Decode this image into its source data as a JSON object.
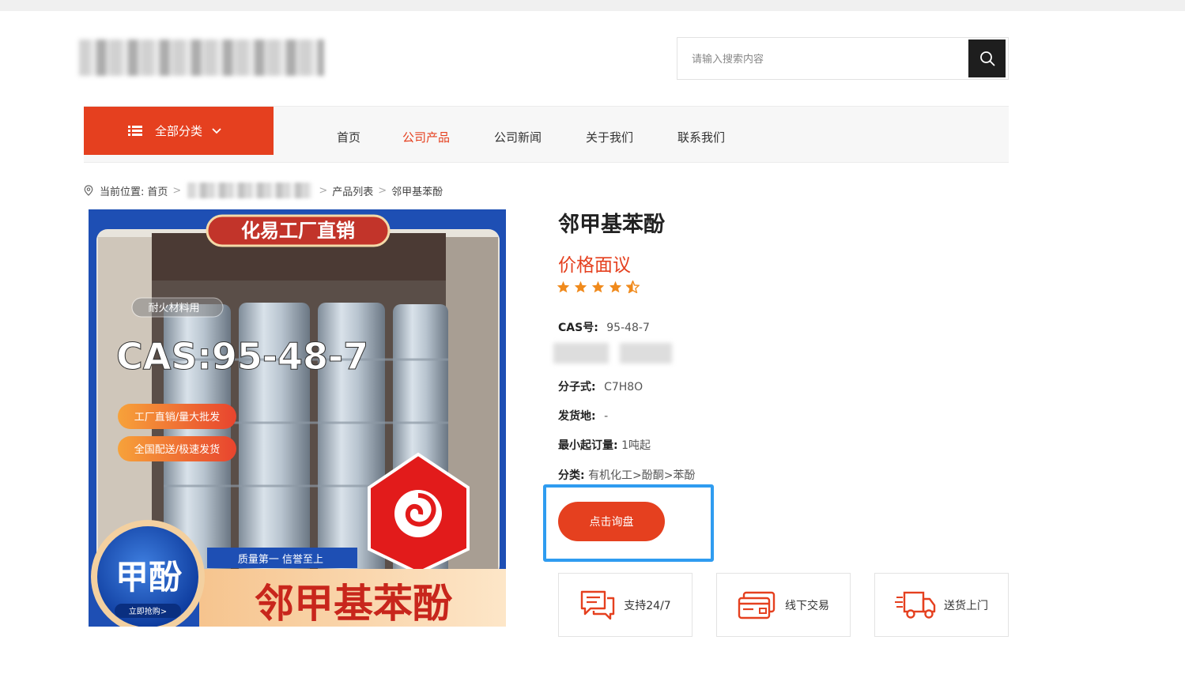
{
  "search": {
    "placeholder": "请输入搜索内容"
  },
  "nav": {
    "category_label": "全部分类",
    "items": [
      {
        "label": "首页"
      },
      {
        "label": "公司产品"
      },
      {
        "label": "公司新闻"
      },
      {
        "label": "关于我们"
      },
      {
        "label": "联系我们"
      }
    ],
    "active": "公司产品"
  },
  "breadcrumb": {
    "prefix": "当前位置:",
    "home": "首页",
    "sep": ">",
    "list": "产品列表",
    "current": "邻甲基苯酚"
  },
  "product_image": {
    "banner": "化易工厂直销",
    "tag": "耐火材料用",
    "cas_big": "CAS:95-48-7",
    "pill1": "工厂直销/量大批发",
    "pill2": "全国配送/极速发货",
    "badge": "甲酚",
    "badge_sub": "立即抢购>",
    "quality": "质量第一 信誉至上",
    "name_big": "邻甲基苯酚"
  },
  "product": {
    "title": "邻甲基苯酚",
    "price": "价格面议",
    "rating": 4.5,
    "cas_label": "CAS号:",
    "cas_value": "95-48-7",
    "formula_label": "分子式:",
    "formula_value": "C7H8O",
    "origin_label": "发货地:",
    "origin_value": "-",
    "moq_label": "最小起订量:",
    "moq_value": "1吨起",
    "category_label": "分类:",
    "category_value": "有机化工>酚酮>苯酚",
    "inquiry_label": "点击询盘"
  },
  "services": [
    {
      "label": "支持24/7",
      "icon": "chat-icon"
    },
    {
      "label": "线下交易",
      "icon": "card-icon"
    },
    {
      "label": "送货上门",
      "icon": "truck-icon"
    }
  ],
  "colors": {
    "accent": "#e5401f",
    "highlight": "#2f9cf0",
    "star": "#f08a1c"
  }
}
